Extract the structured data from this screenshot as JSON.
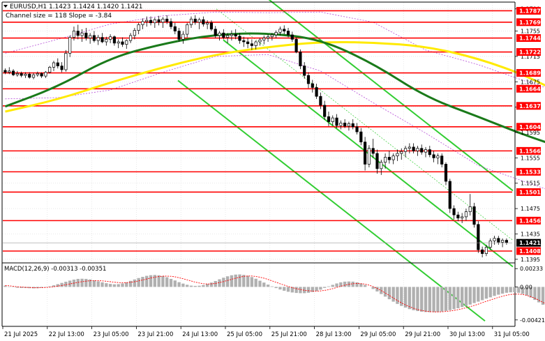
{
  "chart_data": {
    "type": "candlestick",
    "symbol_header": "EURUSD,H1  1.1423 1.1424 1.1420 1.1421",
    "channel_label": "Channel size = 118 Slope = -3.84",
    "price_axis": {
      "range": [
        1.13904,
        1.17996
      ],
      "ticks": [
        "1.1790",
        "1.1755",
        "1.1715",
        "1.1675",
        "1.1635",
        "1.1595",
        "1.1555",
        "1.1515",
        "1.1475",
        "1.1435",
        "1.1395"
      ]
    },
    "levels": [
      "1.1787",
      "1.1769",
      "1.1744",
      "1.1722",
      "1.1689",
      "1.1664",
      "1.1637",
      "1.1604",
      "1.1566",
      "1.1533",
      "1.1501",
      "1.1456",
      "1.1408"
    ],
    "current_price": "1.1421",
    "x_axis_labels": [
      "21 Jul 2025",
      "22 Jul 13:00",
      "23 Jul 05:00",
      "23 Jul 21:00",
      "24 Jul 13:00",
      "25 Jul 05:00",
      "25 Jul 21:00",
      "28 Jul 13:00",
      "29 Jul 05:00",
      "29 Jul 21:00",
      "30 Jul 13:00",
      "31 Jul 05:00"
    ],
    "macd": {
      "label": "MACD(12,26,9) -0.00313 -0.00351",
      "range": [
        -0.00494,
        0.00297
      ],
      "ticks": [
        "0.00233",
        "0.00",
        "-0.00421"
      ],
      "histogram": [
        0.00016,
        4e-05,
        -4e-05,
        -0.00011,
        -0.00014,
        -0.00014,
        -0.00016,
        -0.00018,
        -0.00016,
        -0.00011,
        -4e-05,
        7e-05,
        0.0002,
        0.00035,
        0.00051,
        0.00066,
        0.0008,
        0.00093,
        0.00102,
        0.00104,
        0.00102,
        0.00095,
        0.00084,
        0.00071,
        0.00058,
        0.00047,
        0.00038,
        0.00033,
        0.00035,
        0.00044,
        0.00058,
        0.00077,
        0.00095,
        0.00113,
        0.00128,
        0.00141,
        0.00149,
        0.00152,
        0.00148,
        0.00138,
        0.00123,
        0.00102,
        0.00082,
        0.0006,
        0.00042,
        0.00027,
        0.00016,
        0.00013,
        0.00015,
        0.00024,
        0.00038,
        0.00055,
        0.00075,
        0.00097,
        0.00117,
        0.00135,
        0.00148,
        0.00157,
        0.00159,
        0.00153,
        0.00142,
        0.00125,
        0.00104,
        0.00079,
        0.00055,
        0.00029,
        7e-05,
        -0.00015,
        -0.00033,
        -0.00049,
        -0.00062,
        -0.00071,
        -0.00077,
        -0.0008,
        -0.0008,
        -0.00075,
        -0.00065,
        -0.00052,
        -0.00035,
        -0.00013,
        7e-05,
        0.00026,
        0.00044,
        0.00058,
        0.00067,
        0.00069,
        0.00067,
        0.00058,
        0.00044,
        0.00024,
        0,
        -0.00027,
        -0.00058,
        -0.00091,
        -0.00124,
        -0.00157,
        -0.00188,
        -0.00217,
        -0.00243,
        -0.00264,
        -0.00283,
        -0.00297,
        -0.00308,
        -0.00316,
        -0.0032,
        -0.00322,
        -0.00322,
        -0.00319,
        -0.00314,
        -0.00306,
        -0.00296,
        -0.00284,
        -0.00272,
        -0.00257,
        -0.00241,
        -0.00225,
        -0.00206,
        -0.00188,
        -0.00169,
        -0.0015,
        -0.00133,
        -0.00115,
        -0.00099,
        -0.00086,
        -0.00075,
        -0.00069,
        -0.00068,
        -0.00075,
        -0.00089,
        -0.00109,
        -0.00135,
        -0.00166,
        -0.00197,
        -0.00228,
        -0.00258,
        -0.00283,
        -0.00306,
        -0.00322,
        -0.00335,
        -0.00341,
        -0.00341,
        -0.00337,
        -0.00328
      ],
      "signal": [
        0.00018,
        0.00014,
        7e-05,
        2e-05,
        -2e-05,
        -5e-05,
        -8e-05,
        -0.0001,
        -0.00011,
        -0.0001,
        -8e-05,
        -4e-05,
        2e-05,
        0.0001,
        0.00018,
        0.00028,
        0.00038,
        0.00048,
        0.00058,
        0.00067,
        0.00073,
        0.00078,
        0.0008,
        0.00079,
        0.00077,
        0.00072,
        0.00066,
        0.0006,
        0.00055,
        0.00052,
        0.00054,
        0.00059,
        0.00066,
        0.00077,
        0.00088,
        0.00101,
        0.00113,
        0.00124,
        0.00132,
        0.00137,
        0.00137,
        0.00135,
        0.00128,
        0.00117,
        0.00104,
        0.0009,
        0.00076,
        0.00061,
        0.0005,
        0.00041,
        0.00037,
        0.00039,
        0.00044,
        0.00055,
        0.00068,
        0.00082,
        0.00097,
        0.00111,
        0.00124,
        0.00134,
        0.00139,
        0.00139,
        0.00133,
        0.00124,
        0.00111,
        0.00095,
        0.00077,
        0.00059,
        0.0004,
        0.00023,
        6e-05,
        -9e-05,
        -0.00023,
        -0.00033,
        -0.00043,
        -0.00049,
        -0.00053,
        -0.00054,
        -0.00051,
        -0.00044,
        -0.00035,
        -0.00022,
        -7e-05,
        8e-05,
        0.00022,
        0.00033,
        0.00041,
        0.00044,
        0.00042,
        0.00035,
        0.00022,
        4e-05,
        -0.00019,
        -0.00046,
        -0.00077,
        -0.00109,
        -0.00142,
        -0.00174,
        -0.00203,
        -0.00229,
        -0.00252,
        -0.00272,
        -0.00288,
        -0.003,
        -0.00309,
        -0.00315,
        -0.00318,
        -0.00319,
        -0.00317,
        -0.00313,
        -0.00307,
        -0.003,
        -0.0029,
        -0.00279,
        -0.00266,
        -0.00252,
        -0.00236,
        -0.0022,
        -0.00202,
        -0.00184,
        -0.00167,
        -0.0015,
        -0.00133,
        -0.00119,
        -0.00106,
        -0.00097,
        -0.00092,
        -0.00092,
        -0.00097,
        -0.00108,
        -0.00124,
        -0.00145,
        -0.0017,
        -0.00196,
        -0.00223,
        -0.00249,
        -0.00272,
        -0.00294,
        -0.00311,
        -0.00324,
        -0.00333,
        -0.00337,
        -0.00337
      ]
    },
    "colors": {
      "level_line": "#ff0000",
      "bull": "#000000",
      "bear": "#000000",
      "ma_fast": "#1a7a1a",
      "ma_slow": "#ffea00",
      "bands": "#b54bd6",
      "channel": "#32cd32",
      "grid": "#d9d9d9",
      "macd_hist": "#b0b0b0",
      "macd_signal": "#ff0000"
    },
    "candles": [
      [
        1.1693,
        1.1696,
        1.1687,
        1.169
      ],
      [
        1.169,
        1.1698,
        1.1687,
        1.1692
      ],
      [
        1.1692,
        1.1695,
        1.1684,
        1.1686
      ],
      [
        1.1686,
        1.1692,
        1.1683,
        1.1688
      ],
      [
        1.1688,
        1.1691,
        1.1682,
        1.1685
      ],
      [
        1.1685,
        1.169,
        1.1681,
        1.1687
      ],
      [
        1.1687,
        1.169,
        1.168,
        1.1682
      ],
      [
        1.1682,
        1.1689,
        1.1679,
        1.1686
      ],
      [
        1.1686,
        1.1691,
        1.1683,
        1.1688
      ],
      [
        1.1688,
        1.169,
        1.1681,
        1.1684
      ],
      [
        1.1684,
        1.1692,
        1.1681,
        1.169
      ],
      [
        1.169,
        1.17,
        1.1688,
        1.1698
      ],
      [
        1.1698,
        1.1708,
        1.1692,
        1.1705
      ],
      [
        1.1705,
        1.1712,
        1.1696,
        1.17
      ],
      [
        1.17,
        1.1706,
        1.169,
        1.1694
      ],
      [
        1.1694,
        1.1725,
        1.1691,
        1.172
      ],
      [
        1.172,
        1.1748,
        1.1714,
        1.1745
      ],
      [
        1.1745,
        1.1762,
        1.174,
        1.1755
      ],
      [
        1.1755,
        1.1765,
        1.1742,
        1.1748
      ],
      [
        1.1748,
        1.1758,
        1.1738,
        1.1752
      ],
      [
        1.1752,
        1.176,
        1.174,
        1.1744
      ],
      [
        1.1744,
        1.1752,
        1.1735,
        1.1748
      ],
      [
        1.1748,
        1.1755,
        1.1737,
        1.174
      ],
      [
        1.174,
        1.1749,
        1.1733,
        1.1745
      ],
      [
        1.1745,
        1.1752,
        1.1736,
        1.1738
      ],
      [
        1.1738,
        1.1746,
        1.1732,
        1.1742
      ],
      [
        1.1742,
        1.175,
        1.1736,
        1.1746
      ],
      [
        1.1746,
        1.1748,
        1.1732,
        1.1736
      ],
      [
        1.1736,
        1.1742,
        1.1728,
        1.1738
      ],
      [
        1.1738,
        1.1745,
        1.173,
        1.1734
      ],
      [
        1.1734,
        1.1742,
        1.1727,
        1.174
      ],
      [
        1.174,
        1.1752,
        1.1736,
        1.1748
      ],
      [
        1.1748,
        1.176,
        1.1742,
        1.1756
      ],
      [
        1.1756,
        1.1768,
        1.175,
        1.1765
      ],
      [
        1.1765,
        1.1775,
        1.1758,
        1.177
      ],
      [
        1.177,
        1.1778,
        1.1762,
        1.1772
      ],
      [
        1.1772,
        1.1778,
        1.1764,
        1.1768
      ],
      [
        1.1768,
        1.1776,
        1.176,
        1.1773
      ],
      [
        1.1773,
        1.1779,
        1.1764,
        1.1769
      ],
      [
        1.1769,
        1.1777,
        1.176,
        1.1774
      ],
      [
        1.1774,
        1.178,
        1.1766,
        1.177
      ],
      [
        1.177,
        1.1775,
        1.1758,
        1.1762
      ],
      [
        1.1762,
        1.1768,
        1.175,
        1.1755
      ],
      [
        1.1755,
        1.176,
        1.1738,
        1.1742
      ],
      [
        1.1742,
        1.1755,
        1.1735,
        1.175
      ],
      [
        1.175,
        1.1768,
        1.1745,
        1.1765
      ],
      [
        1.1765,
        1.1778,
        1.176,
        1.1774
      ],
      [
        1.1774,
        1.178,
        1.1765,
        1.1769
      ],
      [
        1.1769,
        1.1776,
        1.1758,
        1.1773
      ],
      [
        1.1773,
        1.1778,
        1.1762,
        1.1766
      ],
      [
        1.1766,
        1.1772,
        1.1758,
        1.1768
      ],
      [
        1.1768,
        1.1772,
        1.1755,
        1.1758
      ],
      [
        1.1758,
        1.1763,
        1.1744,
        1.1748
      ],
      [
        1.1748,
        1.1755,
        1.174,
        1.1752
      ],
      [
        1.1752,
        1.1758,
        1.1742,
        1.1745
      ],
      [
        1.1745,
        1.1752,
        1.1736,
        1.1748
      ],
      [
        1.1748,
        1.1756,
        1.174,
        1.175
      ],
      [
        1.175,
        1.1758,
        1.1742,
        1.1747
      ],
      [
        1.1747,
        1.1752,
        1.1735,
        1.174
      ],
      [
        1.174,
        1.1746,
        1.173,
        1.1738
      ],
      [
        1.1738,
        1.1744,
        1.1728,
        1.1735
      ],
      [
        1.1735,
        1.1742,
        1.1725,
        1.1732
      ],
      [
        1.1732,
        1.174,
        1.1726,
        1.1738
      ],
      [
        1.1738,
        1.1744,
        1.1732,
        1.1741
      ],
      [
        1.1741,
        1.1748,
        1.1734,
        1.1744
      ],
      [
        1.1744,
        1.175,
        1.1738,
        1.1746
      ],
      [
        1.1746,
        1.1752,
        1.174,
        1.1749
      ],
      [
        1.1749,
        1.1756,
        1.1744,
        1.1753
      ],
      [
        1.1753,
        1.1762,
        1.1748,
        1.1758
      ],
      [
        1.1758,
        1.1764,
        1.175,
        1.1755
      ],
      [
        1.1755,
        1.176,
        1.1745,
        1.1749
      ],
      [
        1.1749,
        1.1754,
        1.1738,
        1.1742
      ],
      [
        1.1742,
        1.1745,
        1.172,
        1.1722
      ],
      [
        1.1722,
        1.1726,
        1.1695,
        1.17
      ],
      [
        1.17,
        1.1706,
        1.168,
        1.1685
      ],
      [
        1.1685,
        1.169,
        1.1665,
        1.1672
      ],
      [
        1.1672,
        1.1678,
        1.1658,
        1.1666
      ],
      [
        1.1666,
        1.1672,
        1.1648,
        1.1652
      ],
      [
        1.1652,
        1.1658,
        1.1632,
        1.1638
      ],
      [
        1.1638,
        1.1645,
        1.1615,
        1.162
      ],
      [
        1.162,
        1.1628,
        1.1605,
        1.1612
      ],
      [
        1.1612,
        1.1622,
        1.1606,
        1.1618
      ],
      [
        1.1618,
        1.1624,
        1.1602,
        1.1606
      ],
      [
        1.1606,
        1.1614,
        1.16,
        1.161
      ],
      [
        1.161,
        1.1616,
        1.1602,
        1.1605
      ],
      [
        1.1605,
        1.1612,
        1.1598,
        1.1609
      ],
      [
        1.1609,
        1.1616,
        1.16,
        1.1604
      ],
      [
        1.1604,
        1.161,
        1.1592,
        1.1596
      ],
      [
        1.1596,
        1.1602,
        1.1575,
        1.158
      ],
      [
        1.158,
        1.1588,
        1.1535,
        1.1545
      ],
      [
        1.1545,
        1.1575,
        1.154,
        1.157
      ],
      [
        1.157,
        1.1585,
        1.1555,
        1.1562
      ],
      [
        1.1562,
        1.1568,
        1.153,
        1.1538
      ],
      [
        1.1538,
        1.1552,
        1.1528,
        1.1548
      ],
      [
        1.1548,
        1.1562,
        1.1538,
        1.1556
      ],
      [
        1.1556,
        1.1566,
        1.1546,
        1.1552
      ],
      [
        1.1552,
        1.1562,
        1.1545,
        1.1558
      ],
      [
        1.1558,
        1.1568,
        1.155,
        1.1562
      ],
      [
        1.1562,
        1.157,
        1.1552,
        1.1565
      ],
      [
        1.1565,
        1.1574,
        1.1556,
        1.157
      ],
      [
        1.157,
        1.1578,
        1.1562,
        1.1572
      ],
      [
        1.1572,
        1.1578,
        1.1562,
        1.1566
      ],
      [
        1.1566,
        1.1574,
        1.1558,
        1.157
      ],
      [
        1.157,
        1.1576,
        1.156,
        1.1564
      ],
      [
        1.1564,
        1.1572,
        1.1556,
        1.1568
      ],
      [
        1.1568,
        1.1574,
        1.1556,
        1.156
      ],
      [
        1.156,
        1.1566,
        1.1548,
        1.1555
      ],
      [
        1.1555,
        1.1562,
        1.1545,
        1.1558
      ],
      [
        1.1558,
        1.1562,
        1.154,
        1.1545
      ],
      [
        1.1545,
        1.1548,
        1.1512,
        1.1518
      ],
      [
        1.1518,
        1.1522,
        1.1468,
        1.1475
      ],
      [
        1.1475,
        1.148,
        1.1458,
        1.1465
      ],
      [
        1.1465,
        1.147,
        1.1455,
        1.146
      ],
      [
        1.146,
        1.1468,
        1.1452,
        1.1462
      ],
      [
        1.1462,
        1.1475,
        1.1456,
        1.147
      ],
      [
        1.147,
        1.1498,
        1.1464,
        1.1478
      ],
      [
        1.1478,
        1.1484,
        1.1445,
        1.145
      ],
      [
        1.145,
        1.1455,
        1.1405,
        1.141
      ],
      [
        1.141,
        1.1415,
        1.1398,
        1.1404
      ],
      [
        1.1404,
        1.1418,
        1.14,
        1.1414
      ],
      [
        1.1414,
        1.1428,
        1.141,
        1.1424
      ],
      [
        1.1424,
        1.1432,
        1.1418,
        1.1428
      ],
      [
        1.1428,
        1.1432,
        1.1418,
        1.1422
      ],
      [
        1.1422,
        1.1428,
        1.1414,
        1.1425
      ],
      [
        1.1425,
        1.1428,
        1.1418,
        1.1421
      ]
    ],
    "ma_fast": [
      [
        0,
        1.1636
      ],
      [
        13,
        1.1667
      ],
      [
        26,
        1.1713
      ],
      [
        39,
        1.1735
      ],
      [
        52,
        1.175
      ],
      [
        65,
        1.1752
      ],
      [
        78,
        1.1742
      ],
      [
        91,
        1.1704
      ],
      [
        104,
        1.1651
      ],
      [
        117,
        1.162
      ],
      [
        130,
        1.1587
      ],
      [
        143,
        1.1561
      ],
      [
        156,
        1.1546
      ],
      [
        169,
        1.1503
      ],
      [
        182,
        1.1456
      ]
    ],
    "ma_slow": [
      [
        0,
        1.1628
      ],
      [
        13,
        1.1647
      ],
      [
        26,
        1.1674
      ],
      [
        39,
        1.1698
      ],
      [
        52,
        1.1718
      ],
      [
        65,
        1.173
      ],
      [
        78,
        1.1738
      ],
      [
        91,
        1.1737
      ],
      [
        104,
        1.1731
      ],
      [
        117,
        1.1712
      ],
      [
        130,
        1.1682
      ],
      [
        143,
        1.1637
      ],
      [
        156,
        1.1592
      ],
      [
        169,
        1.155
      ],
      [
        182,
        1.1522
      ]
    ],
    "bands_upper": [
      [
        0,
        1.172
      ],
      [
        13,
        1.1742
      ],
      [
        26,
        1.1766
      ],
      [
        39,
        1.1779
      ],
      [
        52,
        1.1785
      ],
      [
        65,
        1.1784
      ],
      [
        78,
        1.1785
      ],
      [
        91,
        1.1769
      ],
      [
        104,
        1.1725
      ],
      [
        117,
        1.1702
      ],
      [
        130,
        1.1673
      ],
      [
        143,
        1.1648
      ],
      [
        156,
        1.1611
      ],
      [
        169,
        1.1592
      ],
      [
        182,
        1.1558
      ]
    ],
    "bands_lower": [
      [
        0,
        1.1648
      ],
      [
        13,
        1.165
      ],
      [
        26,
        1.1662
      ],
      [
        39,
        1.169
      ],
      [
        52,
        1.1715
      ],
      [
        65,
        1.1718
      ],
      [
        78,
        1.1692
      ],
      [
        91,
        1.1642
      ],
      [
        104,
        1.1594
      ],
      [
        117,
        1.1543
      ],
      [
        130,
        1.1514
      ],
      [
        143,
        1.1485
      ],
      [
        156,
        1.1452
      ],
      [
        169,
        1.1415
      ],
      [
        182,
        1.1398
      ]
    ]
  }
}
